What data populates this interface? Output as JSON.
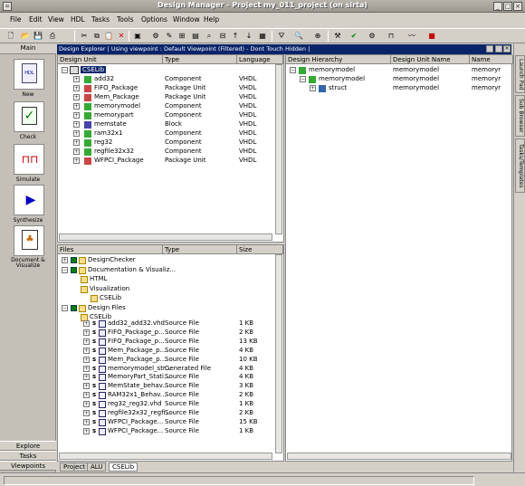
{
  "window": {
    "title": "Design Manager - Project my_011_project (on sirta)"
  },
  "menu": [
    "File",
    "Edit",
    "View",
    "HDL",
    "Tasks",
    "Tools",
    "Options",
    "Window",
    "Help"
  ],
  "leftbar": {
    "header": "Main",
    "buttons": [
      {
        "label": "New",
        "icon": "hdl-file-icon"
      },
      {
        "label": "Check",
        "icon": "check-icon"
      },
      {
        "label": "Simulate",
        "icon": "waveform-icon"
      },
      {
        "label": "Synthesize",
        "icon": "synthesize-icon"
      },
      {
        "label": "Document & Visualize",
        "icon": "document-icon"
      }
    ],
    "tabs": [
      "Explore",
      "Tasks",
      "Viewpoints"
    ]
  },
  "explorer": {
    "title": "Design Explorer | Using viewpoint : Default Viewpoint (Filtered) - Dont Touch Hidden |",
    "columns": [
      "Design Unit",
      "Type",
      "Language"
    ],
    "root": "CSELib",
    "rows": [
      {
        "name": "add32",
        "type": "Component",
        "language": "VHDL"
      },
      {
        "name": "FIFO_Package",
        "type": "Package Unit",
        "language": "VHDL"
      },
      {
        "name": "Mem_Package",
        "type": "Package Unit",
        "language": "VHDL"
      },
      {
        "name": "memorymodel",
        "type": "Component",
        "language": "VHDL"
      },
      {
        "name": "memorypart",
        "type": "Component",
        "language": "VHDL"
      },
      {
        "name": "memstate",
        "type": "Block",
        "language": "VHDL"
      },
      {
        "name": "ram32x1",
        "type": "Component",
        "language": "VHDL"
      },
      {
        "name": "reg32",
        "type": "Component",
        "language": "VHDL"
      },
      {
        "name": "regfile32x32",
        "type": "Component",
        "language": "VHDL"
      },
      {
        "name": "WFPCI_Package",
        "type": "Package Unit",
        "language": "VHDL"
      }
    ]
  },
  "files": {
    "columns": [
      "Files",
      "Type",
      "Size"
    ],
    "tree": [
      {
        "label": "DesignChecker",
        "level": 0
      },
      {
        "label": "Documentation & Visualiz...",
        "level": 0
      },
      {
        "label": "HTML",
        "level": 1
      },
      {
        "label": "Visualization",
        "level": 1
      },
      {
        "label": "CSELib",
        "level": 2
      },
      {
        "label": "Design Files",
        "level": 0
      },
      {
        "label": "CSELib",
        "level": 1
      }
    ],
    "rows": [
      {
        "name": "add32_add32.vhd",
        "type": "Source File",
        "size": "1 KB"
      },
      {
        "name": "FIFO_Package_p...",
        "type": "Source File",
        "size": "2 KB"
      },
      {
        "name": "FIFO_Package_p...",
        "type": "Source File",
        "size": "13 KB"
      },
      {
        "name": "Mem_Package_p...",
        "type": "Source File",
        "size": "4 KB"
      },
      {
        "name": "Mem_Package_p...",
        "type": "Source File",
        "size": "10 KB"
      },
      {
        "name": "memorymodel_str...",
        "type": "Generated File",
        "size": "4 KB"
      },
      {
        "name": "MemoryPart_Stati...",
        "type": "Source File",
        "size": "4 KB"
      },
      {
        "name": "MemState_behav...",
        "type": "Source File",
        "size": "3 KB"
      },
      {
        "name": "RAM32x1_Behav...",
        "type": "Source File",
        "size": "2 KB"
      },
      {
        "name": "reg32_reg32.vhd",
        "type": "Source File",
        "size": "1 KB"
      },
      {
        "name": "regfile32x32_regfi...",
        "type": "Source File",
        "size": "2 KB"
      },
      {
        "name": "WFPCI_Package...",
        "type": "Source File",
        "size": "15 KB"
      },
      {
        "name": "WFPCI_Package...",
        "type": "Source File",
        "size": "1 KB"
      }
    ]
  },
  "hierarchy": {
    "columns": [
      "Design Hierarchy",
      "Design Unit Name",
      "Name"
    ],
    "rows": [
      {
        "label": "memorymodel",
        "unit": "memorymodel",
        "name": "memoryr",
        "level": 0
      },
      {
        "label": "memorymodel",
        "unit": "memorymodel",
        "name": "memoryr",
        "level": 1
      },
      {
        "label": "struct",
        "unit": "memorymodel",
        "name": "memoryr",
        "level": 2
      }
    ]
  },
  "bottom_tabs": [
    "Project",
    "ALU",
    "CSELib"
  ],
  "right_tabs": [
    "Launch Pad",
    "Sub Browser",
    "Tasks/Templates"
  ],
  "colors": {
    "selection": "#0a246a",
    "title_bg": "#9c988f",
    "window_bg": "#d4d0c8"
  }
}
